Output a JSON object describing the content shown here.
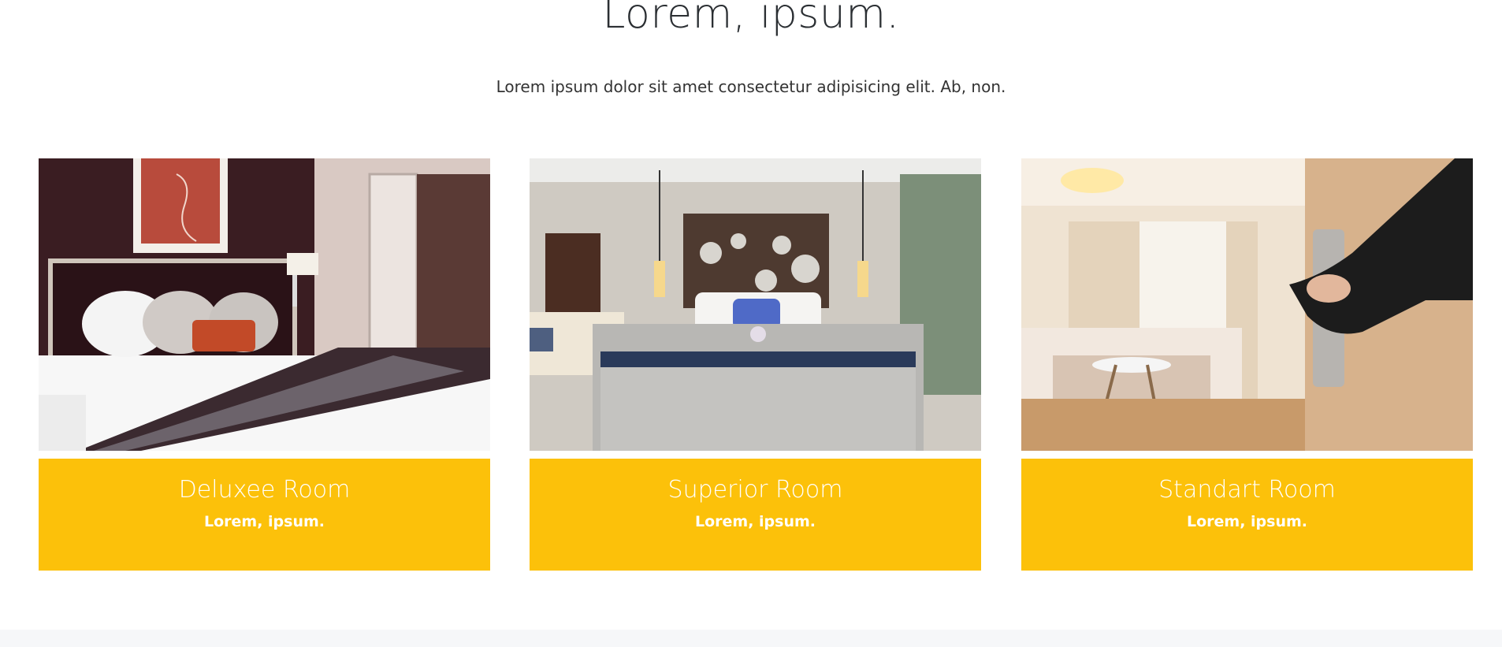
{
  "section": {
    "title": "Lorem, ipsum.",
    "subtitle": "Lorem ipsum dolor sit amet consectetur adipisicing elit. Ab, non."
  },
  "rooms": [
    {
      "title": "Deluxee Room",
      "subtitle": "Lorem, ipsum.",
      "photo": "hotel-bed-with-headboard-photo"
    },
    {
      "title": "Superior Room",
      "subtitle": "Lorem, ipsum.",
      "photo": "hotel-bed-with-lamps-photo"
    },
    {
      "title": "Standart Room",
      "subtitle": "Lorem, ipsum.",
      "photo": "hand-opening-door-photo"
    }
  ],
  "colors": {
    "caption_bg": "#fcc10a",
    "caption_text": "#ffffff",
    "footer_strip": "#f6f7f9"
  }
}
